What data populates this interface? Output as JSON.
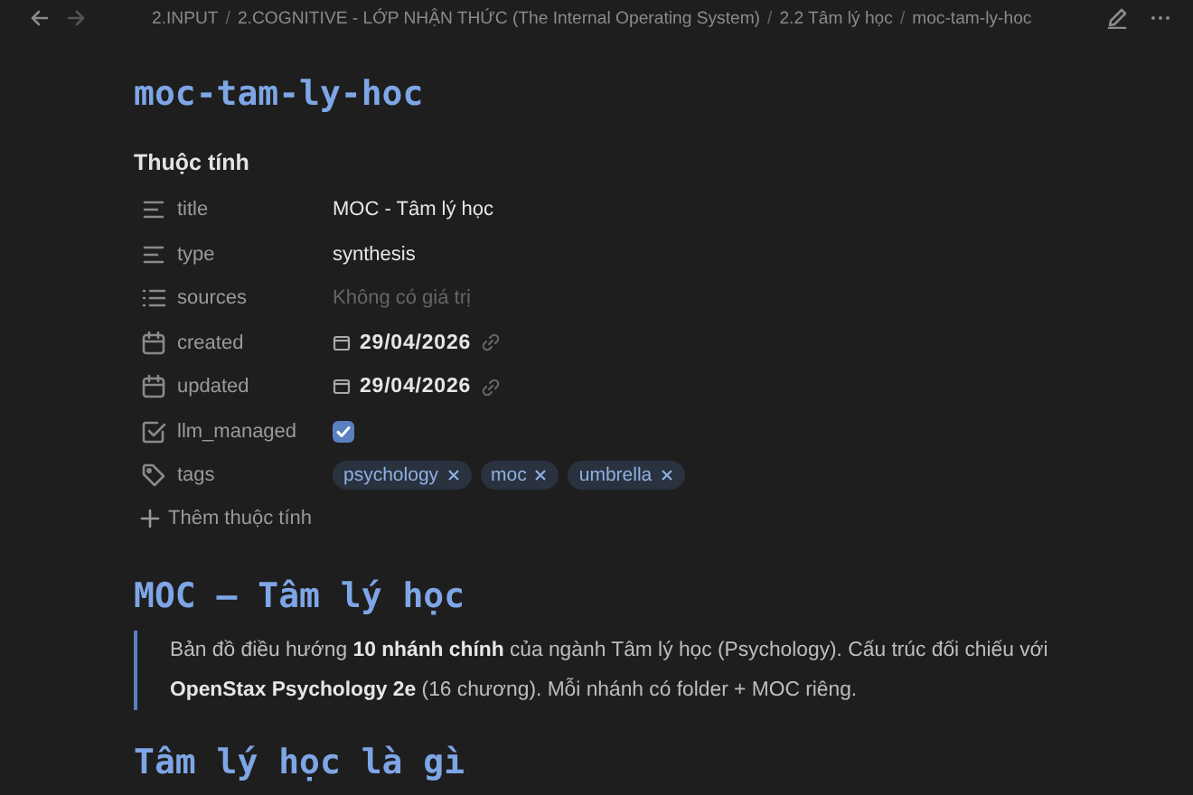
{
  "breadcrumbs": [
    {
      "kind": "link",
      "text": "2.INPUT"
    },
    {
      "kind": "separator",
      "text": "/"
    },
    {
      "kind": "link",
      "text": "2.COGNITIVE - LỚP NHẬN THỨC (The Internal Operating System)"
    },
    {
      "kind": "separator",
      "text": "/"
    },
    {
      "kind": "link",
      "text": "2.2 Tâm lý học"
    },
    {
      "kind": "separator",
      "text": "/"
    },
    {
      "kind": "link",
      "text": "moc-tam-ly-hoc"
    }
  ],
  "note_title": "moc-tam-ly-hoc",
  "properties": {
    "heading": "Thuộc tính",
    "add_label": "Thêm thuộc tính",
    "items": [
      {
        "kind": "text",
        "name": "title",
        "value": "MOC - Tâm lý học"
      },
      {
        "kind": "text",
        "name": "type",
        "value": "synthesis"
      },
      {
        "kind": "list",
        "name": "sources",
        "placeholder": "Không có giá trị"
      },
      {
        "kind": "date",
        "name": "created",
        "value": "29/04/2026"
      },
      {
        "kind": "date",
        "name": "updated",
        "value": "29/04/2026"
      },
      {
        "kind": "checkbox",
        "name": "llm_managed",
        "checked": true
      },
      {
        "kind": "tags",
        "name": "tags",
        "tags": [
          "psychology",
          "moc",
          "umbrella"
        ]
      }
    ]
  },
  "content": [
    {
      "kind": "heading",
      "text": "MOC — Tâm lý học"
    },
    {
      "kind": "quote",
      "text": "Bản đồ điều hướng **10 nhánh chính** của ngành Tâm lý học (Psychology). Cấu trúc đối chiếu với **OpenStax Psychology 2e** (16 chương). Mỗi nhánh có folder + MOC riêng."
    },
    {
      "kind": "heading",
      "text": "Tâm lý học là gì"
    }
  ]
}
